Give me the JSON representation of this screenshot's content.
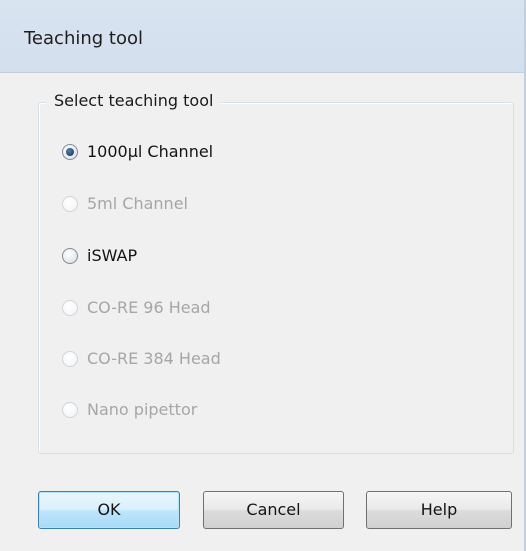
{
  "window": {
    "title": "Teaching tool"
  },
  "group": {
    "legend": "Select teaching tool",
    "options": [
      {
        "label": "1000µl Channel",
        "checked": true,
        "enabled": true
      },
      {
        "label": "5ml Channel",
        "checked": false,
        "enabled": false
      },
      {
        "label": "iSWAP",
        "checked": false,
        "enabled": true
      },
      {
        "label": "CO-RE 96 Head",
        "checked": false,
        "enabled": false
      },
      {
        "label": "CO-RE 384 Head",
        "checked": false,
        "enabled": false
      },
      {
        "label": "Nano pipettor",
        "checked": false,
        "enabled": false
      }
    ]
  },
  "buttons": {
    "ok": "OK",
    "cancel": "Cancel",
    "help": "Help"
  },
  "colors": {
    "titlebar": "#d7e3f0",
    "dialog_background": "#f0f0f0",
    "disabled_text": "#a6a6a6",
    "default_button_border": "#3c7fb1"
  }
}
